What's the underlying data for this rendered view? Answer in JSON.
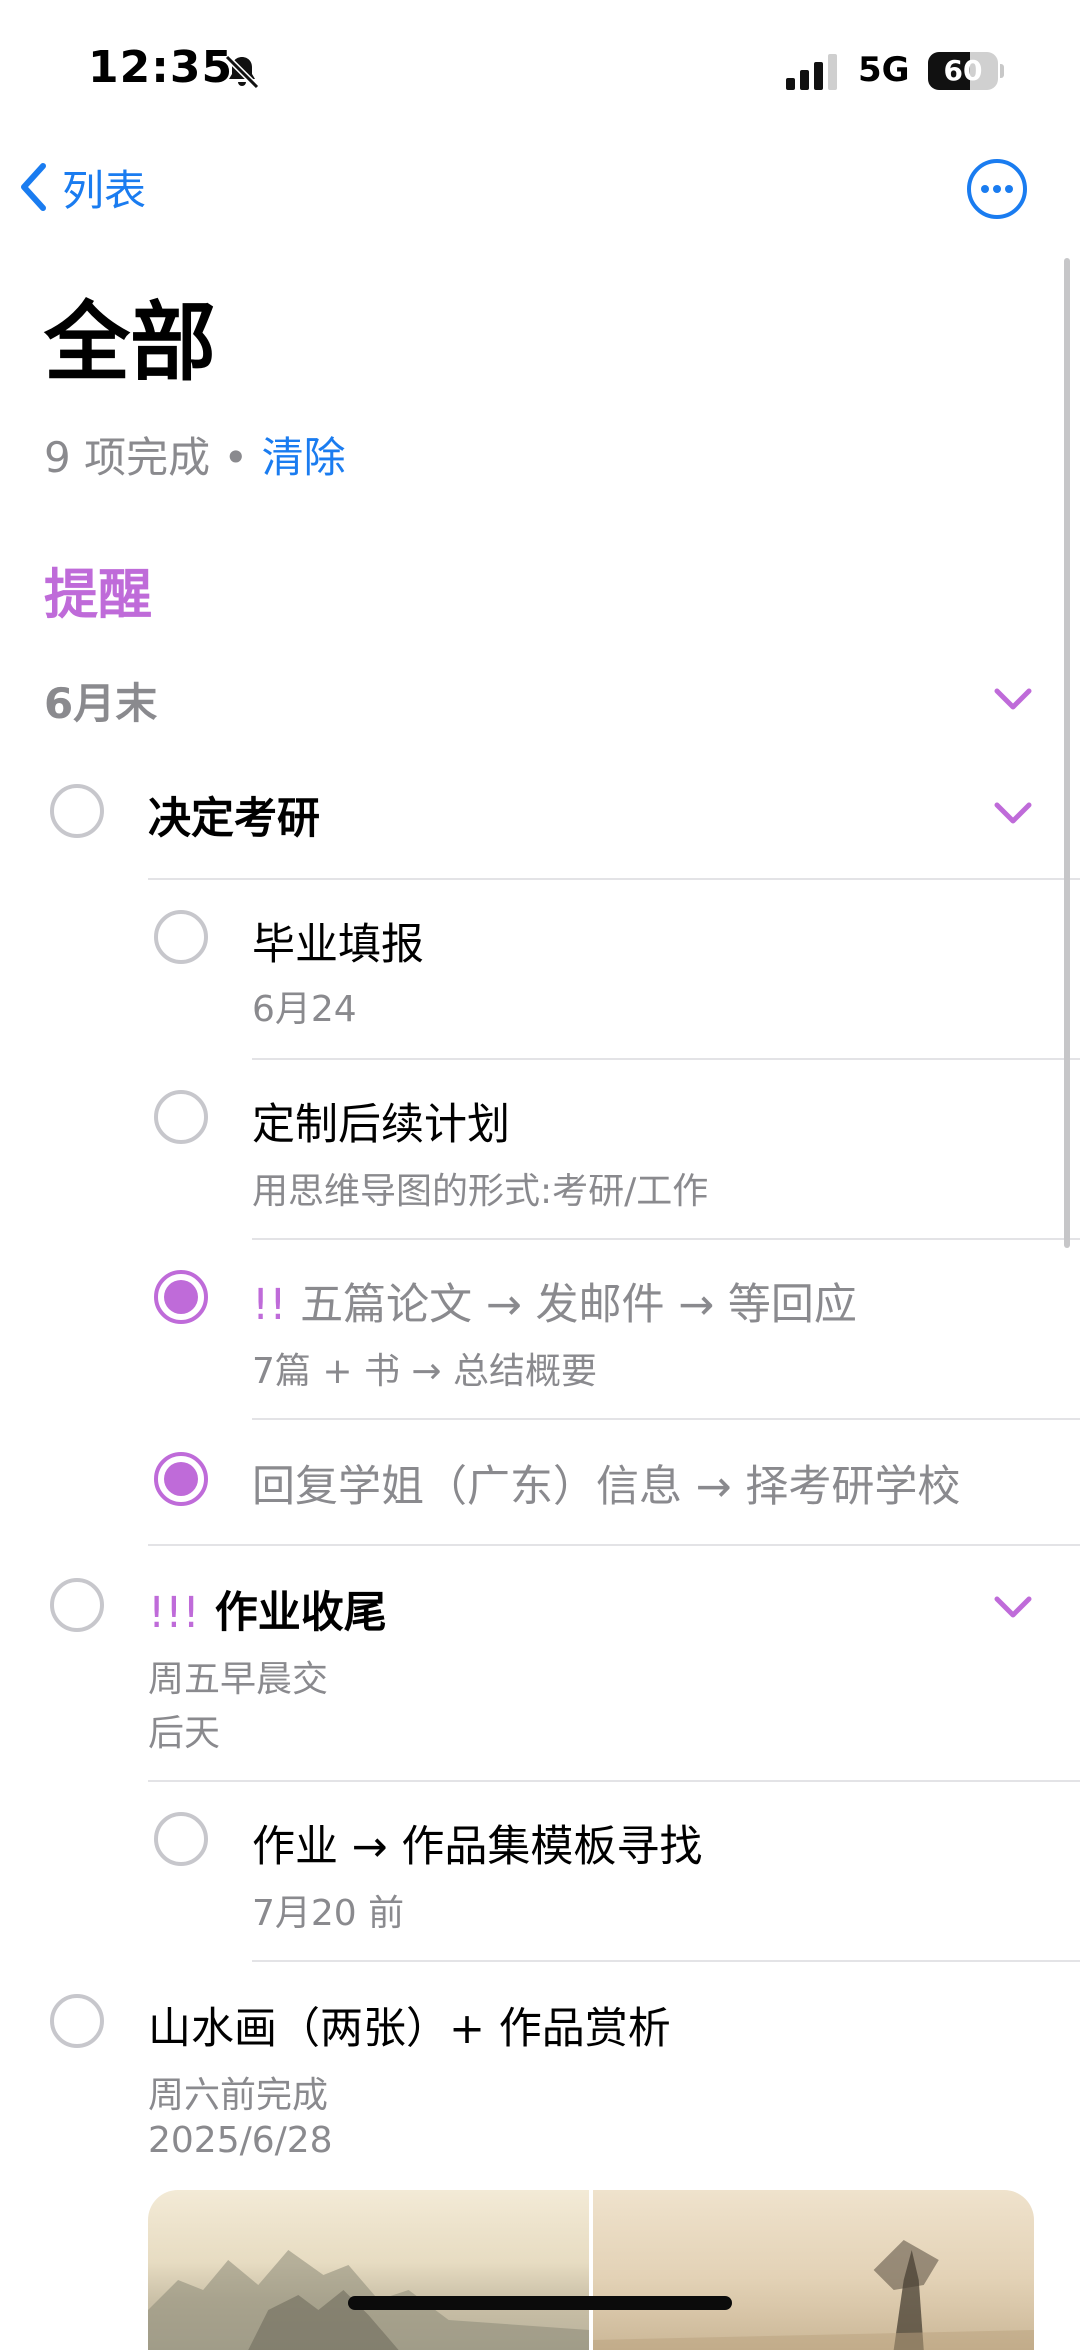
{
  "status_bar": {
    "time": "12:35",
    "network": "5G",
    "battery": "60",
    "battery_level": 0.6
  },
  "nav": {
    "back_label": "列表"
  },
  "page": {
    "title": "全部",
    "completed_text": "9 项完成 • ",
    "clear_label": "清除"
  },
  "section": {
    "title": "提醒"
  },
  "group": {
    "title": "6月末"
  },
  "reminders": {
    "r1": {
      "title": "决定考研"
    },
    "r1a": {
      "title": "毕业填报",
      "sub": "6月24"
    },
    "r1b": {
      "title": "定制后续计划",
      "sub": "用思维导图的形式:考研/工作"
    },
    "r1c": {
      "priority": "!!",
      "title": "五篇论文 → 发邮件 → 等回应",
      "sub": "7篇 + 书 → 总结概要"
    },
    "r1d": {
      "title": "回复学姐（广东）信息 → 择考研学校"
    },
    "r2": {
      "priority": "!!!",
      "title": "作业收尾",
      "sub1": "周五早晨交",
      "sub2": "后天"
    },
    "r2a": {
      "title": "作业 → 作品集模板寻找",
      "sub": "7月20 前"
    },
    "r3": {
      "title": "山水画（两张）+ 作品赏析",
      "sub1": "周六前完成",
      "sub2": "2025/6/28"
    }
  },
  "icons": {
    "back": "chevron-left-icon",
    "more": "ellipsis-circle-icon",
    "bell": "bell-slash-icon",
    "signal": "cellular-signal-icon",
    "chevron": "chevron-down-icon"
  },
  "colors": {
    "accent": "#bf6bd9",
    "link": "#1a7cf0",
    "secondary_text": "#8a8a8e"
  }
}
